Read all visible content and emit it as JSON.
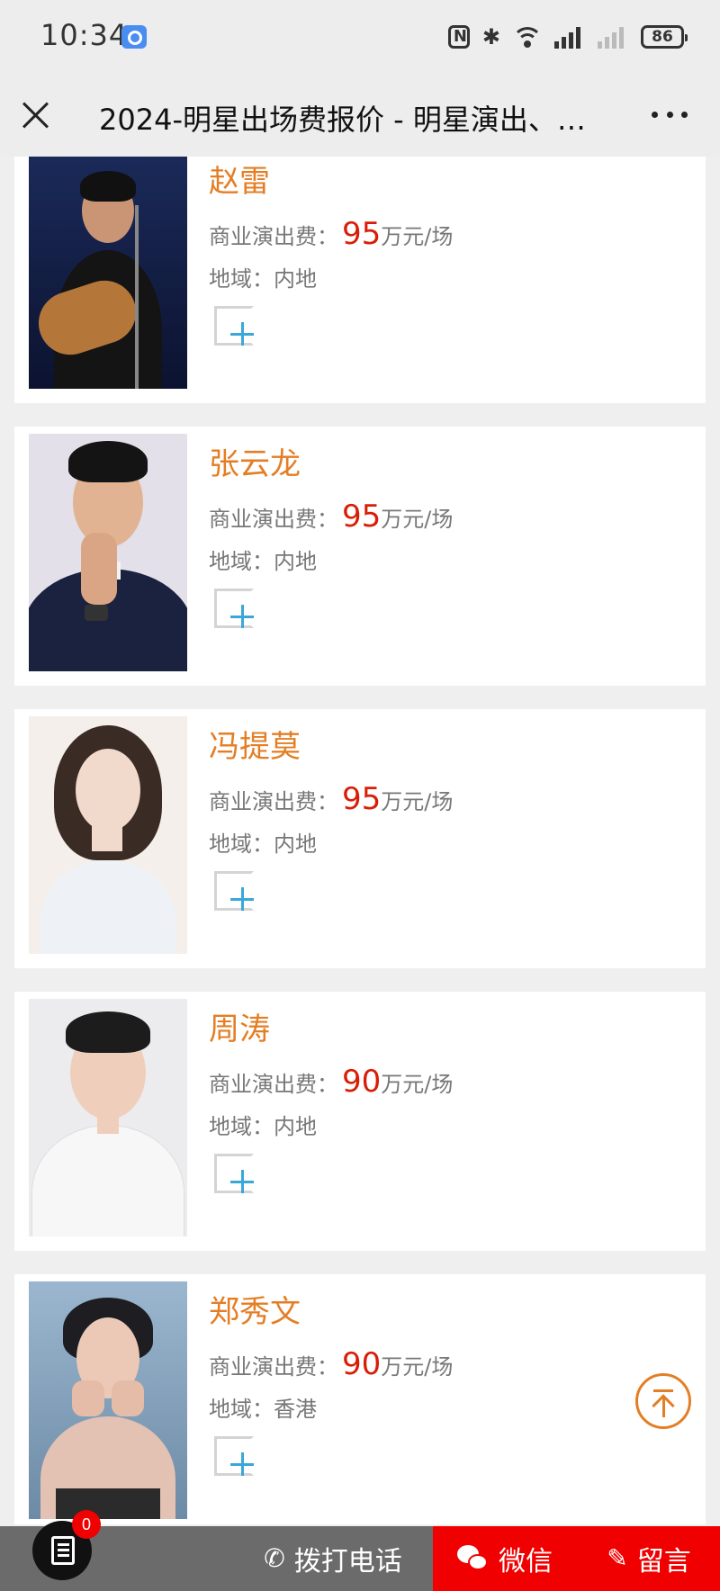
{
  "status_bar": {
    "time": "10:34",
    "battery": "86",
    "icons": [
      "app-icon",
      "nfc-icon",
      "bluetooth-icon",
      "wifi-icon",
      "signal-icon",
      "signal-icon-sim2",
      "battery-icon"
    ]
  },
  "nav": {
    "title": "2024-明星出场费报价 - 明星演出、…",
    "close_icon": "close-icon",
    "more_icon": "more-icon"
  },
  "fee_label": "商业演出费：",
  "region_label": "地域：",
  "unit": "万元/场",
  "stars": [
    {
      "name": "赵雷",
      "price": "95",
      "region": "内地"
    },
    {
      "name": "张云龙",
      "price": "95",
      "region": "内地"
    },
    {
      "name": "冯提莫",
      "price": "95",
      "region": "内地"
    },
    {
      "name": "周涛",
      "price": "90",
      "region": "内地"
    },
    {
      "name": "郑秀文",
      "price": "90",
      "region": "香港"
    }
  ],
  "bottom_bar": {
    "doc_badge": "0",
    "call_label": "拨打电话",
    "wechat_label": "微信",
    "message_label": "留言"
  },
  "colors": {
    "name": "#e47e24",
    "price": "#d81e06",
    "bottom_bar": "#6b6b6b",
    "accent_red": "#f00000"
  }
}
